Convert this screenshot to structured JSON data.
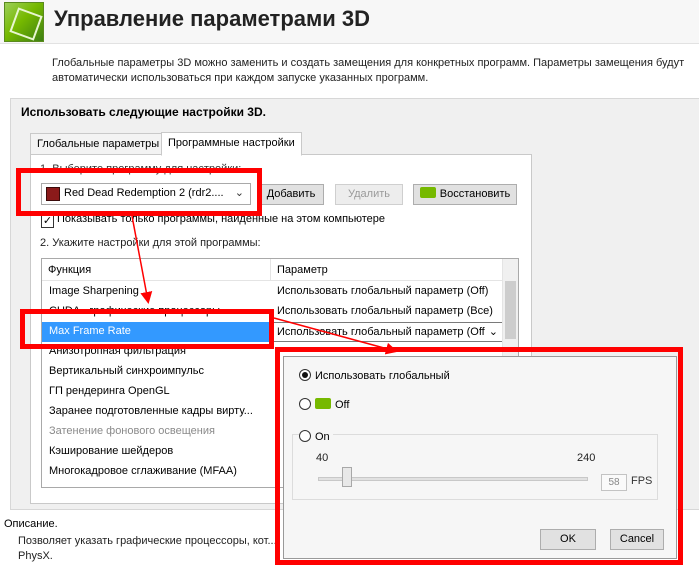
{
  "header": {
    "title": "Управление параметрами 3D"
  },
  "intro": {
    "text": "Глобальные параметры 3D можно заменить и создать замещения для конкретных программ. Параметры замещения будут автоматически использоваться при каждом запуске указанных программ."
  },
  "panel": {
    "title": "Использовать следующие настройки 3D."
  },
  "tabs": [
    {
      "label": "Глобальные параметры",
      "active": false
    },
    {
      "label": "Программные настройки",
      "active": true
    }
  ],
  "step1": {
    "label": "1. Выберите программу для настройки:"
  },
  "program_select": {
    "value": "Red Dead Redemption 2 (rdr2....",
    "icon": "game-icon"
  },
  "buttons": {
    "add": "Добавить",
    "remove": "Удалить",
    "restore": "Восстановить"
  },
  "show_only_checkbox": {
    "label": "Показывать только программы, найденные на этом компьютере",
    "checked": true
  },
  "step2": {
    "label": "2. Укажите настройки для этой программы:"
  },
  "table": {
    "headers": {
      "function": "Функция",
      "parameter": "Параметр"
    },
    "rows": [
      {
        "function": "Image Sharpening",
        "parameter": "Использовать глобальный параметр (Off)"
      },
      {
        "function": "CUDA - графические процессоры",
        "parameter": "Использовать глобальный параметр (Все)"
      },
      {
        "function": "Max Frame Rate",
        "parameter": "Использовать глобальный параметр (Off"
      },
      {
        "function": "Анизотропная фильтрация",
        "parameter": ""
      },
      {
        "function": "Вертикальный синхроимпульс",
        "parameter": ""
      },
      {
        "function": "ГП рендеринга OpenGL",
        "parameter": ""
      },
      {
        "function": "Заранее подготовленные кадры вирту...",
        "parameter": ""
      },
      {
        "function": "Затенение фонового освещения",
        "parameter": ""
      },
      {
        "function": "Кэширование шейдеров",
        "parameter": ""
      },
      {
        "function": "Многокадровое сглаживание (MFAA)",
        "parameter": ""
      }
    ]
  },
  "description": {
    "label": "Описание.",
    "text": "Позволяет указать графические процессоры, кот... PhysX."
  },
  "popup": {
    "option_global": "Использовать глобальный",
    "option_off": "Off",
    "option_on": "On",
    "slider_min": "40",
    "slider_max": "240",
    "fps_value": "58",
    "fps_unit": "FPS",
    "ok": "OK",
    "cancel": "Cancel"
  },
  "colors": {
    "highlight": "#ff0000",
    "selection": "#3399ff",
    "nvidia_green": "#76b900"
  }
}
